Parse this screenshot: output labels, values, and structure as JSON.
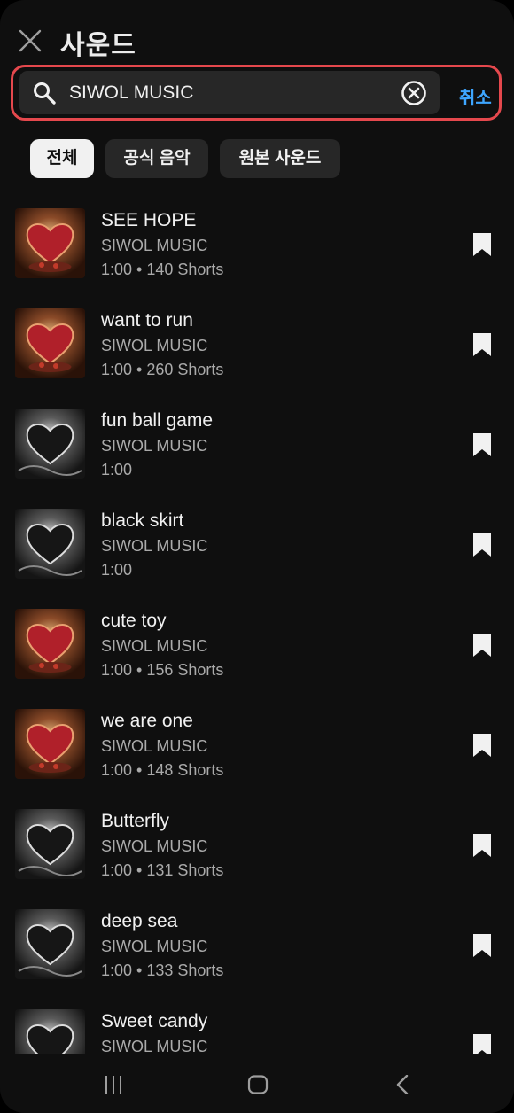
{
  "header": {
    "title": "사운드"
  },
  "search": {
    "query": "SIWOL MUSIC",
    "cancel_label": "취소"
  },
  "filters": [
    {
      "label": "전체",
      "active": true
    },
    {
      "label": "공식 음악",
      "active": false
    },
    {
      "label": "원본 사운드",
      "active": false
    }
  ],
  "songs": [
    {
      "title": "SEE HOPE",
      "artist": "SIWOL MUSIC",
      "meta": "1:00 • 140 Shorts",
      "art": "red-heart"
    },
    {
      "title": "want to run",
      "artist": "SIWOL MUSIC",
      "meta": "1:00 • 260 Shorts",
      "art": "red-heart"
    },
    {
      "title": "fun ball game",
      "artist": "SIWOL MUSIC",
      "meta": "1:00",
      "art": "dark-heart"
    },
    {
      "title": "black skirt",
      "artist": "SIWOL MUSIC",
      "meta": "1:00",
      "art": "dark-heart"
    },
    {
      "title": "cute toy",
      "artist": "SIWOL MUSIC",
      "meta": "1:00 • 156 Shorts",
      "art": "red-heart"
    },
    {
      "title": "we are one",
      "artist": "SIWOL MUSIC",
      "meta": "1:00 • 148 Shorts",
      "art": "red-heart"
    },
    {
      "title": "Butterfly",
      "artist": "SIWOL MUSIC",
      "meta": "1:00 • 131 Shorts",
      "art": "dark-heart"
    },
    {
      "title": "deep sea",
      "artist": "SIWOL MUSIC",
      "meta": "1:00 • 133 Shorts",
      "art": "dark-heart"
    },
    {
      "title": "Sweet candy",
      "artist": "SIWOL MUSIC",
      "meta": "",
      "art": "dark-heart"
    }
  ],
  "colors": {
    "background": "#0f0f0f",
    "accent": "#3ea6ff",
    "highlight_border": "#e5484d"
  }
}
